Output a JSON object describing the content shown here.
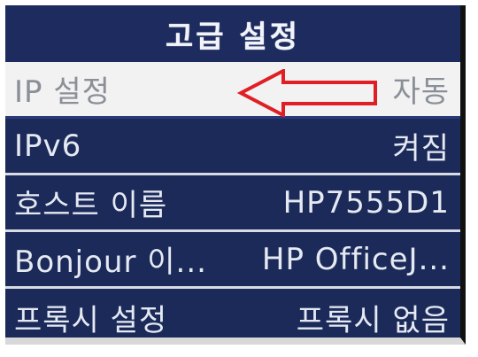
{
  "header": {
    "title": "고급 설정"
  },
  "menu": {
    "items": [
      {
        "label": "IP 설정",
        "value": "자동"
      },
      {
        "label": "IPv6",
        "value": "켜짐"
      },
      {
        "label": "호스트 이름",
        "value": "HP7555D1"
      },
      {
        "label": "Bonjour 이...",
        "value": "HP OfficeJ..."
      },
      {
        "label": "프록시 설정",
        "value": "프록시 없음"
      }
    ]
  },
  "colors": {
    "screen_bg": "#1c2a5a",
    "highlight_bg": "#f2f2f2",
    "annotation_arrow": "#e01e25"
  }
}
